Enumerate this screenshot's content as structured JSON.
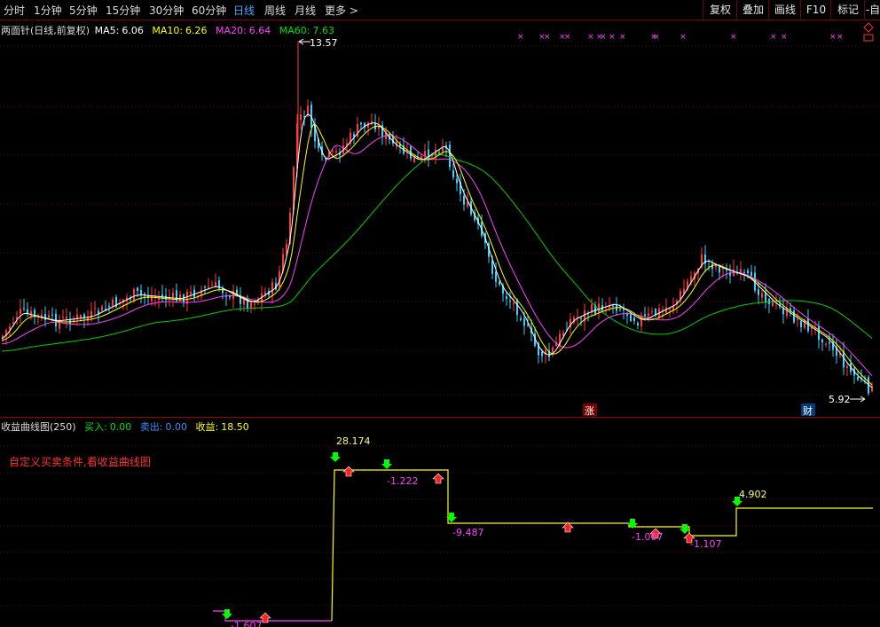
{
  "toolbar": {
    "timeframes": [
      "分时",
      "1分钟",
      "5分钟",
      "15分钟",
      "30分钟",
      "60分钟",
      "日线",
      "周线",
      "月线",
      "更多 >"
    ],
    "active_timeframe": "日线",
    "right_buttons": [
      "复权",
      "叠加",
      "画线",
      "F10",
      "标记",
      "-自"
    ]
  },
  "main_chart": {
    "indicator_name": "两面针(日线,前复权)",
    "ma": [
      {
        "label": "MA5:",
        "value": "6.06",
        "color": "#ffffff"
      },
      {
        "label": "MA10:",
        "value": "6.26",
        "color": "#ffff00"
      },
      {
        "label": "MA20:",
        "value": "6.64",
        "color": "#ff40ff"
      },
      {
        "label": "MA60:",
        "value": "7.63",
        "color": "#00e000"
      }
    ],
    "high_label": "13.57",
    "low_label": "5.92",
    "markers": [
      {
        "text": "涨"
      },
      {
        "text": "财"
      }
    ]
  },
  "lower_chart": {
    "title": "收益曲线图(250)",
    "buy": {
      "label": "买入:",
      "value": "0.00"
    },
    "sell": {
      "label": "卖出:",
      "value": "0.00"
    },
    "profit": {
      "label": "收益:",
      "value": "18.50"
    },
    "note": "自定义买卖条件,看收益曲线图",
    "values": [
      {
        "text": "28.174",
        "color": "#ffff66"
      },
      {
        "text": "-1.222",
        "color": "#ff40ff"
      },
      {
        "text": "-9.487",
        "color": "#ff40ff"
      },
      {
        "text": "-1.007",
        "color": "#ff40ff"
      },
      {
        "text": "-1.107",
        "color": "#ff40ff"
      },
      {
        "text": "4.902",
        "color": "#ffff66"
      },
      {
        "text": "-1.607",
        "color": "#ff40ff"
      }
    ]
  },
  "colors": {
    "up": "#ff3c3c",
    "down": "#3cd2ff",
    "grid": "#6b0000",
    "profit_line": "#ffff00",
    "loss_line": "#ff40ff",
    "buy_arrow": "#00ff00",
    "sell_arrow": "#ff2020"
  },
  "icons": {
    "buy": "green-down-arrow-icon",
    "sell": "red-up-arrow-icon",
    "marker": "pink-x-icon"
  }
}
